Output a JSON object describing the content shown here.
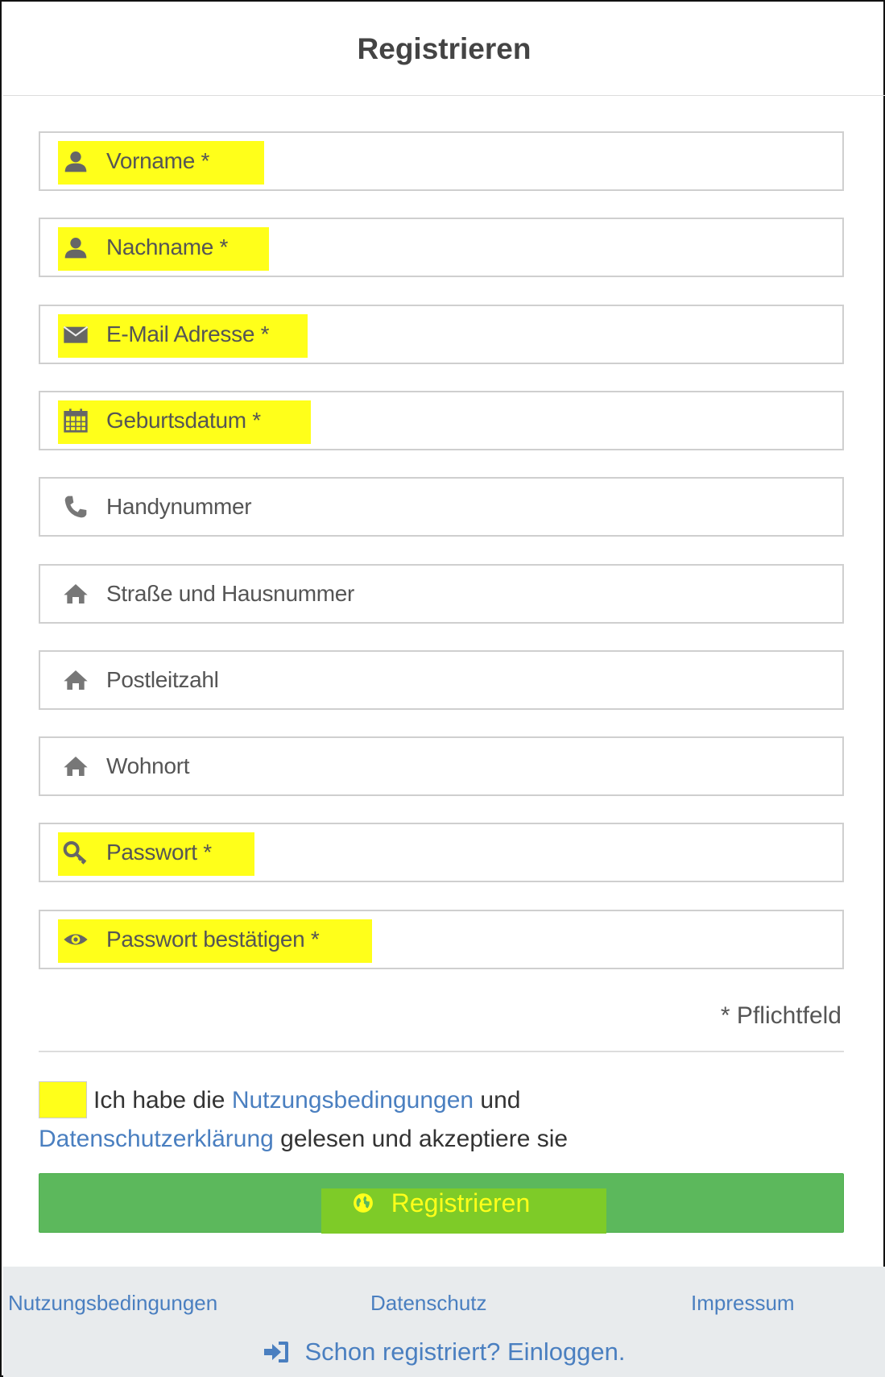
{
  "header": {
    "title": "Registrieren"
  },
  "fields": [
    {
      "name": "vorname-field",
      "icon": "user-icon",
      "placeholder": "Vorname *",
      "highlighted": true
    },
    {
      "name": "nachname-field",
      "icon": "user-icon",
      "placeholder": "Nachname *",
      "highlighted": true
    },
    {
      "name": "email-field",
      "icon": "envelope-icon",
      "placeholder": "E-Mail Adresse *",
      "highlighted": true
    },
    {
      "name": "geburtsdatum-field",
      "icon": "calendar-icon",
      "placeholder": "Geburtsdatum *",
      "highlighted": true
    },
    {
      "name": "handynummer-field",
      "icon": "phone-icon",
      "placeholder": "Handynummer",
      "highlighted": false
    },
    {
      "name": "strasse-field",
      "icon": "home-icon",
      "placeholder": "Straße und Hausnummer",
      "highlighted": false
    },
    {
      "name": "postleitzahl-field",
      "icon": "home-icon",
      "placeholder": "Postleitzahl",
      "highlighted": false
    },
    {
      "name": "wohnort-field",
      "icon": "home-icon",
      "placeholder": "Wohnort",
      "highlighted": false
    },
    {
      "name": "passwort-field",
      "icon": "key-icon",
      "placeholder": "Passwort *",
      "highlighted": true
    },
    {
      "name": "passwort-bestaetigen-field",
      "icon": "eye-icon",
      "placeholder": "Passwort bestätigen *",
      "highlighted": true
    }
  ],
  "required_note": "* Pflichtfeld",
  "terms": {
    "text_1": "Ich habe die",
    "link_1": "Nutzungsbedingungen",
    "text_2": "und",
    "link_2": "Datenschutzerklärung",
    "text_3": "gelesen und akzeptiere sie"
  },
  "submit": {
    "label": "Registrieren",
    "icon": "globe-icon"
  },
  "footer": {
    "link_terms": "Nutzungsbedingungen",
    "link_privacy": "Datenschutz",
    "link_imprint": "Impressum",
    "login_label": "Schon registriert? Einloggen.",
    "login_icon": "sign-in-icon"
  },
  "colors": {
    "highlight": "#ffff1a",
    "button": "#5cb85c",
    "link": "#4a7fc0",
    "icon": "#666666"
  }
}
